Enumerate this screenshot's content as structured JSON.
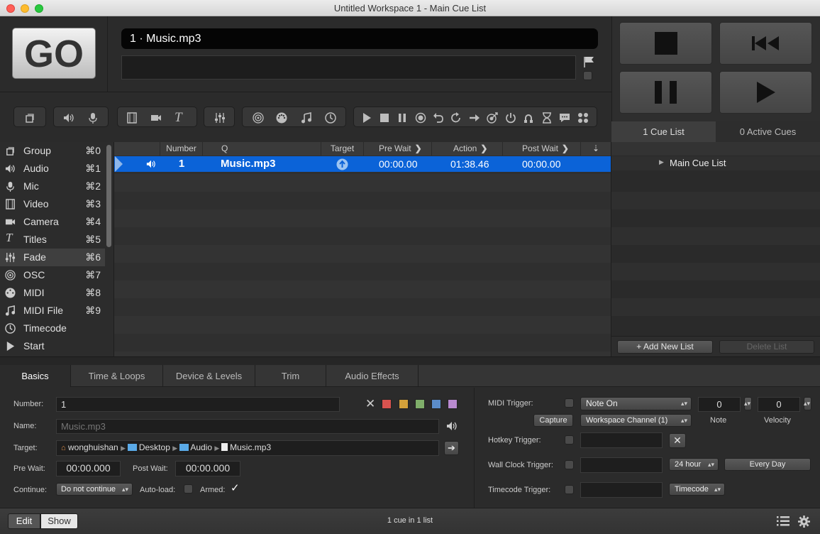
{
  "window": {
    "title": "Untitled Workspace 1 - Main Cue List"
  },
  "go": {
    "label": "GO"
  },
  "standby": {
    "cue_name": "1 · Music.mp3"
  },
  "cuelists": {
    "tab1": "1 Cue List",
    "tab2": "0 Active Cues",
    "list_name": "Main Cue List",
    "add_label": "+ Add New List",
    "delete_label": "Delete List"
  },
  "sidebar": {
    "items": [
      {
        "label": "Group",
        "key": "⌘0",
        "icon": "group-icon"
      },
      {
        "label": "Audio",
        "key": "⌘1",
        "icon": "audio-icon"
      },
      {
        "label": "Mic",
        "key": "⌘2",
        "icon": "mic-icon"
      },
      {
        "label": "Video",
        "key": "⌘3",
        "icon": "video-icon"
      },
      {
        "label": "Camera",
        "key": "⌘4",
        "icon": "camera-icon"
      },
      {
        "label": "Titles",
        "key": "⌘5",
        "icon": "titles-icon"
      },
      {
        "label": "Fade",
        "key": "⌘6",
        "icon": "fade-icon"
      },
      {
        "label": "OSC",
        "key": "⌘7",
        "icon": "osc-icon"
      },
      {
        "label": "MIDI",
        "key": "⌘8",
        "icon": "midi-icon"
      },
      {
        "label": "MIDI File",
        "key": "⌘9",
        "icon": "midi-file-icon"
      },
      {
        "label": "Timecode",
        "key": "",
        "icon": "timecode-icon"
      },
      {
        "label": "Start",
        "key": "",
        "icon": "start-icon"
      }
    ]
  },
  "table": {
    "headers": {
      "number": "Number",
      "q": "Q",
      "target": "Target",
      "prewait": "Pre Wait",
      "action": "Action",
      "postwait": "Post Wait"
    },
    "rows": [
      {
        "number": "1",
        "q": "Music.mp3",
        "prewait": "00:00.00",
        "action": "01:38.46",
        "postwait": "00:00.00"
      }
    ]
  },
  "inspector": {
    "tabs": [
      "Basics",
      "Time & Loops",
      "Device & Levels",
      "Trim",
      "Audio Effects"
    ],
    "number_label": "Number:",
    "number_value": "1",
    "name_label": "Name:",
    "name_placeholder": "Music.mp3",
    "target_label": "Target:",
    "target_path": [
      "wonghuishan",
      "Desktop",
      "Audio",
      "Music.mp3"
    ],
    "prewait_label": "Pre Wait:",
    "prewait_value": "00:00.000",
    "postwait_label": "Post Wait:",
    "postwait_value": "00:00.000",
    "continue_label": "Continue:",
    "continue_value": "Do not continue",
    "autoload_label": "Auto-load:",
    "armed_label": "Armed:",
    "colors": [
      "#d9534f",
      "#d4a13a",
      "#7fae6a",
      "#5b8cc9",
      "#b98ad0"
    ],
    "midi_label": "MIDI Trigger:",
    "midi_type": "Note On",
    "capture_label": "Capture",
    "channel_value": "Workspace Channel (1)",
    "note_value": "0",
    "velocity_value": "0",
    "note_label": "Note",
    "velocity_label": "Velocity",
    "hotkey_label": "Hotkey Trigger:",
    "wallclock_label": "Wall Clock Trigger:",
    "hour_value": "24 hour",
    "everyday_label": "Every Day",
    "timecode_label": "Timecode Trigger:",
    "timecode_value": "Timecode"
  },
  "status": {
    "edit": "Edit",
    "show": "Show",
    "summary": "1 cue in 1 list"
  }
}
